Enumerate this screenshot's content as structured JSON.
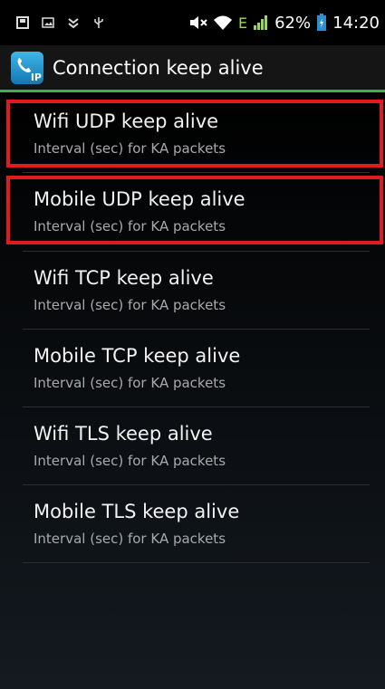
{
  "status_bar": {
    "battery": "62%",
    "time": "14:20",
    "network": "E",
    "icons": [
      "usb-notification-icon",
      "picture-notification-icon",
      "download-notification-icon",
      "usb-icon",
      "mute-icon",
      "wifi-icon",
      "signal-icon",
      "battery-icon"
    ]
  },
  "action_bar": {
    "app_icon_text": "IP",
    "title": "Connection keep alive"
  },
  "items": [
    {
      "label": "Wifi UDP keep alive",
      "summary": "Interval (sec) for KA packets",
      "highlighted": true
    },
    {
      "label": "Mobile UDP keep alive",
      "summary": "Interval (sec) for KA packets",
      "highlighted": true
    },
    {
      "label": "Wifi TCP keep alive",
      "summary": "Interval (sec) for KA packets",
      "highlighted": false
    },
    {
      "label": "Mobile TCP keep alive",
      "summary": "Interval (sec) for KA packets",
      "highlighted": false
    },
    {
      "label": "Wifi TLS keep alive",
      "summary": "Interval (sec) for KA packets",
      "highlighted": false
    },
    {
      "label": "Mobile TLS keep alive",
      "summary": "Interval (sec) for KA packets",
      "highlighted": false
    }
  ],
  "colors": {
    "accent": "#40b04a",
    "highlight": "#e11b1b"
  }
}
